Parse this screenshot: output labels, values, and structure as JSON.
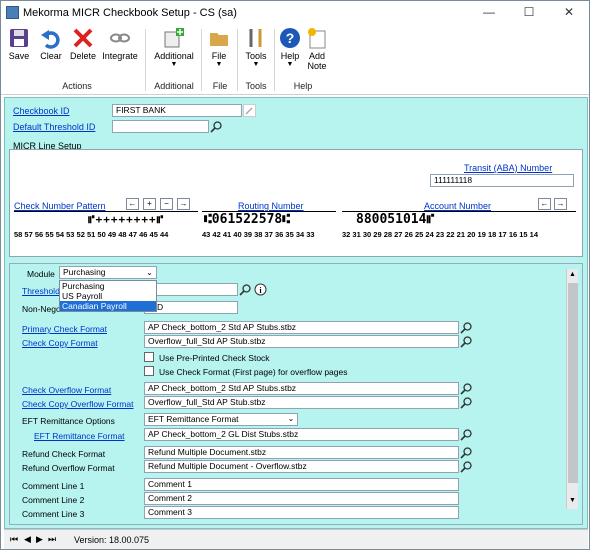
{
  "window": {
    "title": "Mekorma MICR Checkbook Setup  -  CS (sa)"
  },
  "ribbon": {
    "buttons": [
      {
        "label": "Save"
      },
      {
        "label": "Clear"
      },
      {
        "label": "Delete"
      },
      {
        "label": "Integrate"
      },
      {
        "label": "Additional"
      },
      {
        "label": "File"
      },
      {
        "label": "Tools"
      },
      {
        "label": "Help"
      },
      {
        "label": "Add"
      },
      {
        "label": "Note"
      }
    ],
    "groups": [
      "Actions",
      "Additional",
      "File",
      "Tools",
      "Help"
    ]
  },
  "form": {
    "checkbook_id_label": "Checkbook ID",
    "checkbook_id_value": "FIRST BANK",
    "default_threshold_label": "Default Threshold ID",
    "default_threshold_value": "",
    "micr_line_setup_label": "MICR Line Setup"
  },
  "micr": {
    "transit_label": "Transit (ABA) Number",
    "transit_value": "111111118",
    "check_number_pattern_label": "Check Number Pattern",
    "routing_number_label": "Routing Number",
    "account_number_label": "Account Number",
    "check_symbols": "⑈++++++++⑈",
    "routing_symbols": "⑆061522578⑆",
    "account_symbols": "880051014⑈",
    "positions_check": "58 57 56 55 54 53 52 51 50 49 48 47 46 45 44",
    "positions_routing": "43 42 41 40 39 38 37 36 35 34 33",
    "positions_account": "32 31 30 29 28 27 26 25 24 23 22 21 20 19 18 17 16 15 14",
    "nav_left": "←",
    "nav_plus": "+",
    "nav_minus": "−",
    "nav_right": "→"
  },
  "module_section": {
    "module_label": "Module",
    "module_value": "Purchasing",
    "dropdown_options": [
      "Purchasing",
      "US Payroll",
      "Canadian Payroll"
    ],
    "dropdown_selected": "Canadian Payroll",
    "threshold_label": "Threshold",
    "non_negotiable_label": "Non-Negoti",
    "non_negotiable_value": "OID",
    "primary_check_format_label": "Primary Check Format",
    "primary_check_format_value": "AP Check_bottom_2 Std AP Stubs.stbz",
    "check_copy_format_label": "Check Copy Format",
    "check_copy_format_value": "Overflow_full_Std AP Stub.stbz",
    "use_preprinted_label": "Use Pre-Printed Check Stock",
    "use_check_format_label": "Use Check Format (First page) for overflow pages",
    "check_overflow_format_label": "Check Overflow Format",
    "check_overflow_format_value": "AP Check_bottom_2 Std AP Stubs.stbz",
    "check_copy_overflow_label": "Check Copy Overflow Format",
    "check_copy_overflow_value": "Overflow_full_Std AP Stub.stbz",
    "eft_remittance_options_label": "EFT Remittance Options",
    "eft_remittance_options_value": "EFT Remittance Format",
    "eft_remittance_format_label": "EFT Remittance Format",
    "eft_remittance_format_value": "AP Check_bottom_2 GL Dist Stubs.stbz",
    "refund_check_format_label": "Refund Check Format",
    "refund_check_format_value": "Refund Multiple Document.stbz",
    "refund_overflow_format_label": "Refund Overflow Format",
    "refund_overflow_format_value": "Refund Multiple Document - Overflow.stbz",
    "comment1_label": "Comment Line 1",
    "comment1_value": "Comment 1",
    "comment2_label": "Comment Line 2",
    "comment2_value": "Comment 2",
    "comment3_label": "Comment Line 3",
    "comment3_value": "Comment 3"
  },
  "status": {
    "version": "Version: 18.00.075"
  },
  "colors": {
    "accent": "#b7f4f0",
    "link": "#0033cc",
    "selection": "#1e6fd6"
  }
}
